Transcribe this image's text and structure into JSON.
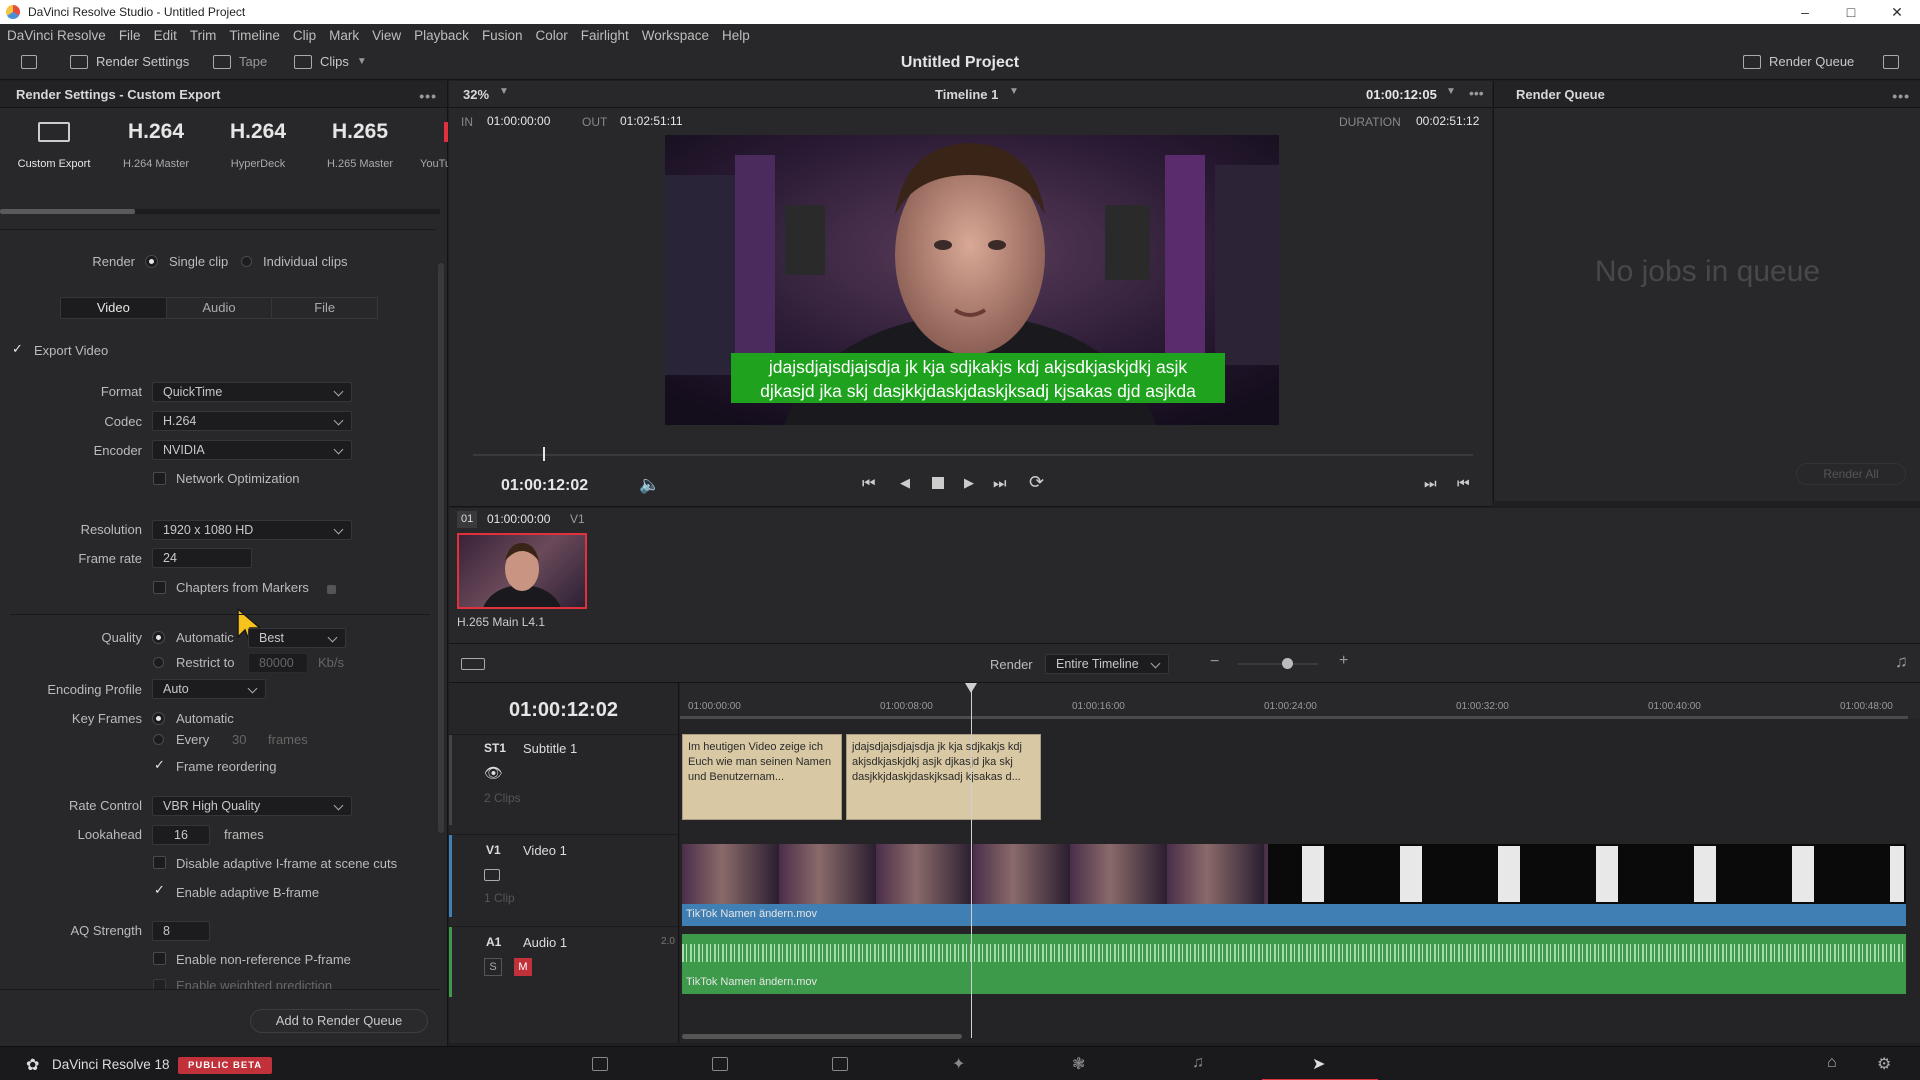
{
  "window": {
    "title": "DaVinci Resolve Studio - Untitled Project",
    "controls": [
      "–",
      "□",
      "✕"
    ]
  },
  "menu": [
    "DaVinci Resolve",
    "File",
    "Edit",
    "Trim",
    "Timeline",
    "Clip",
    "Mark",
    "View",
    "Playback",
    "Fusion",
    "Color",
    "Fairlight",
    "Workspace",
    "Help"
  ],
  "toolbar": {
    "render_settings": "Render Settings",
    "tape": "Tape",
    "clips": "Clips",
    "project_title": "Untitled Project",
    "render_queue": "Render Queue"
  },
  "render_settings": {
    "header": "Render Settings - Custom Export",
    "presets": [
      {
        "big": "",
        "label": "Custom Export"
      },
      {
        "big": "H.264",
        "label": "H.264 Master"
      },
      {
        "big": "H.264",
        "label": "HyperDeck"
      },
      {
        "big": "H.265",
        "label": "H.265 Master"
      },
      {
        "big": "",
        "label": "YouTu"
      }
    ],
    "render_label": "Render",
    "single_clip": "Single clip",
    "individual_clips": "Individual clips",
    "tabs": [
      "Video",
      "Audio",
      "File"
    ],
    "export_video": "Export Video",
    "format_label": "Format",
    "format_value": "QuickTime",
    "codec_label": "Codec",
    "codec_value": "H.264",
    "encoder_label": "Encoder",
    "encoder_value": "NVIDIA",
    "network_opt": "Network Optimization",
    "resolution_label": "Resolution",
    "resolution_value": "1920 x 1080 HD",
    "framerate_label": "Frame rate",
    "framerate_value": "24",
    "chapters": "Chapters from Markers",
    "quality_label": "Quality",
    "quality_auto": "Automatic",
    "quality_best": "Best",
    "restrict_to": "Restrict to",
    "restrict_value": "80000",
    "restrict_unit": "Kb/s",
    "encoding_profile_label": "Encoding Profile",
    "encoding_profile_value": "Auto",
    "keyframes_label": "Key Frames",
    "keyframes_auto": "Automatic",
    "keyframes_every": "Every",
    "keyframes_every_value": "30",
    "keyframes_unit": "frames",
    "frame_reordering": "Frame reordering",
    "rate_control_label": "Rate Control",
    "rate_control_value": "VBR High Quality",
    "lookahead_label": "Lookahead",
    "lookahead_value": "16",
    "lookahead_unit": "frames",
    "disable_iframe": "Disable adaptive I-frame at scene cuts",
    "enable_bframe": "Enable adaptive B-frame",
    "aq_label": "AQ Strength",
    "aq_value": "8",
    "nonref_p": "Enable non-reference P-frame",
    "weighted_pred": "Enable weighted prediction",
    "add_to_queue": "Add to Render Queue"
  },
  "viewer": {
    "zoom": "32%",
    "timeline_name": "Timeline 1",
    "timecode_top": "01:00:12:05",
    "in_label": "IN",
    "in_value": "01:00:00:00",
    "out_label": "OUT",
    "out_value": "01:02:51:11",
    "duration_label": "DURATION",
    "duration_value": "00:02:51:12",
    "subtitle_line1": "jdajsdjajsdjajsdja jk kja sdjkakjs kdj akjsdkjaskjdkj asjk",
    "subtitle_line2": "djkasjd jka skj dasjkkjdaskjdaskjksadj  kjsakas djd asjkda",
    "current_tc": "01:00:12:02",
    "scrub_progress": 0.07
  },
  "render_queue": {
    "title": "Render Queue",
    "empty": "No jobs in queue",
    "render_all": "Render All"
  },
  "clip": {
    "index": "01",
    "tc": "01:00:00:00",
    "track": "V1",
    "codec": "H.265 Main L4.1"
  },
  "timeline": {
    "render_label": "Render",
    "render_range": "Entire Timeline",
    "current_tc": "01:00:12:02",
    "ruler": [
      "01:00:00:00",
      "01:00:08:00",
      "01:00:16:00",
      "01:00:24:00",
      "01:00:32:00",
      "01:00:40:00",
      "01:00:48:00"
    ],
    "tracks": {
      "subtitle": {
        "id": "ST1",
        "name": "Subtitle 1",
        "count": "2 Clips"
      },
      "video": {
        "id": "V1",
        "name": "Video 1",
        "count": "1 Clip"
      },
      "audio": {
        "id": "A1",
        "name": "Audio 1",
        "level": "2.0",
        "s": "S",
        "m": "M"
      }
    },
    "sub_clip1": "Im heutigen Video zeige ich Euch wie man seinen Namen und Benutzernam...",
    "sub_clip2": "jdajsdjajsdjajsdja jk kja sdjkakjs kdj akjsdkjaskjdkj asjk djkasjd jka skj dasjkkjdaskjdaskjksadj  kjsakas d...",
    "video_clip": "TikTok Namen ändern.mov",
    "audio_clip": "TikTok Namen ändern.mov"
  },
  "bottom": {
    "app": "DaVinci Resolve 18",
    "badge": "PUBLIC BETA"
  },
  "colors": {
    "accent_red": "#e0313d",
    "subtitle_green": "#1fa31f",
    "video_blue": "#3f7fb4",
    "audio_green": "#3c9a4a",
    "subtitle_clip": "#d8c9a4"
  }
}
